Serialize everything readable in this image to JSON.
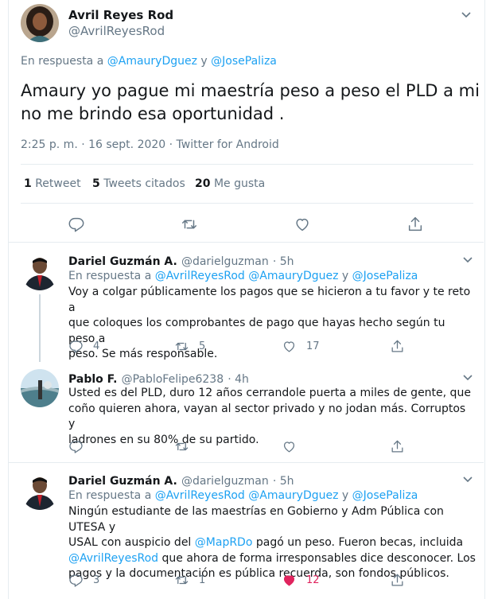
{
  "colors": {
    "accent": "#1da1f2",
    "like_active": "#e0245e",
    "muted": "#657786",
    "border": "#e6ecf0"
  },
  "main_tweet": {
    "name": "Avril Reyes Rod",
    "handle": "@AvrilReyesRod",
    "replying_prefix": "En respuesta a",
    "replying_user1": "@AmauryDguez",
    "replying_and": "y",
    "replying_user2": "@JosePaliza",
    "text_line1": "Amaury yo pague mi maestría peso a peso el PLD a mi",
    "text_line2": "no me brindo esa oportunidad .",
    "timestamp": "2:25 p. m. · 16 sept. 2020 · Twitter for Android",
    "stats": {
      "retweets_count": "1",
      "retweets_label": "Retweet",
      "quotes_count": "5",
      "quotes_label": "Tweets citados",
      "likes_count": "20",
      "likes_label": "Me gusta"
    }
  },
  "replies": [
    {
      "name": "Dariel Guzmán A.",
      "handle": "@darielguzman",
      "time": "· 5h",
      "replying_prefix": "En respuesta a",
      "replying_user1": "@AvrilReyesRod",
      "replying_user2": "@AmauryDguez",
      "replying_and": "y",
      "replying_user3": "@JosePaliza",
      "line1": "Voy a colgar públicamente los pagos que se hicieron a tu favor y te reto a",
      "line2": "que coloques los comprobantes de pago que hayas hecho según tu peso a",
      "line3": "peso. Se más responsable.",
      "reply_count": "4",
      "retweet_count": "5",
      "like_count": "17"
    },
    {
      "name": "Pablo F.",
      "handle": "@PabloFelipe6238",
      "time": "· 4h",
      "line1": "Usted es del PLD, duro 12 años cerrandole puerta a miles de gente, que",
      "line2": "coño quieren ahora, vayan al sector privado y no jodan más.  Corruptos y",
      "line3": "ladrones en su 80% de su partido."
    },
    {
      "name": "Dariel Guzmán A.",
      "handle": "@darielguzman",
      "time": "· 5h",
      "replying_prefix": "En respuesta a",
      "replying_user1": "@AvrilReyesRod",
      "replying_user2": "@AmauryDguez",
      "replying_and": "y",
      "replying_user3": "@JosePaliza",
      "line1": "Ningún estudiante de las maestrías en Gobierno y Adm Pública con UTESA y",
      "line2_prefix": "USAL con auspicio del",
      "line2_mention": "@MapRDo",
      "line2_suffix": "pagó un peso. Fueron becas, incluida",
      "line3_mention": "@AvrilReyesRod",
      "line3_suffix": "que ahora de forma irresponsables dice desconocer. Los",
      "line4": "pagos y la documentación es pública recuerda, son fondos públicos.",
      "reply_count": "3",
      "retweet_count": "1",
      "like_count": "12"
    }
  ]
}
